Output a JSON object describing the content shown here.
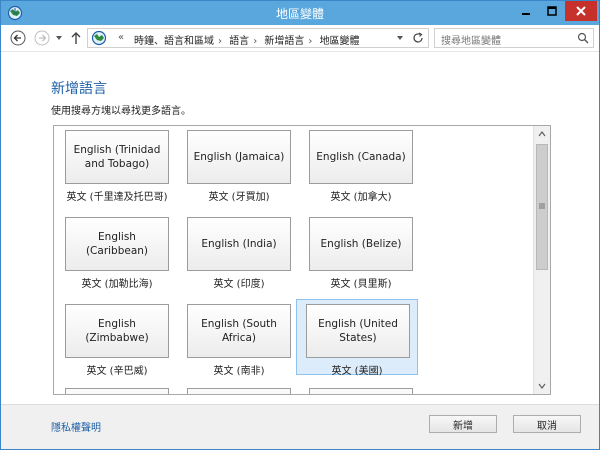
{
  "window": {
    "title": "地區變體"
  },
  "nav": {
    "breadcrumbs": [
      "時鐘、語言和區域",
      "語言",
      "新增語言",
      "地區變體"
    ],
    "chevron": "«",
    "search_placeholder": "搜尋地區變體"
  },
  "page": {
    "heading": "新增語言",
    "hint": "使用搜尋方塊以尋找更多語言。"
  },
  "languages": [
    {
      "label_line1": "English (Trinidad",
      "label_line2": "and Tobago)",
      "caption": "英文 (千里達及托巴哥)",
      "selected": false
    },
    {
      "label_line1": "English (Jamaica)",
      "label_line2": "",
      "caption": "英文 (牙買加)",
      "selected": false
    },
    {
      "label_line1": "English (Canada)",
      "label_line2": "",
      "caption": "英文 (加拿大)",
      "selected": false
    },
    {
      "label_line1": "English",
      "label_line2": "(Caribbean)",
      "caption": "英文 (加勒比海)",
      "selected": false
    },
    {
      "label_line1": "English (India)",
      "label_line2": "",
      "caption": "英文 (印度)",
      "selected": false
    },
    {
      "label_line1": "English (Belize)",
      "label_line2": "",
      "caption": "英文 (貝里斯)",
      "selected": false
    },
    {
      "label_line1": "English",
      "label_line2": "(Zimbabwe)",
      "caption": "英文 (辛巴威)",
      "selected": false
    },
    {
      "label_line1": "English (South",
      "label_line2": "Africa)",
      "caption": "英文 (南非)",
      "selected": false
    },
    {
      "label_line1": "English (United",
      "label_line2": "States)",
      "caption": "英文 (美國)",
      "selected": true
    }
  ],
  "footer": {
    "privacy_link": "隱私權聲明",
    "add_button": "新增",
    "cancel_button": "取消"
  },
  "colors": {
    "accent": "#5aa7dd",
    "link": "#1e5fa6",
    "selection": "#dcecfb",
    "close": "#c7312b"
  }
}
